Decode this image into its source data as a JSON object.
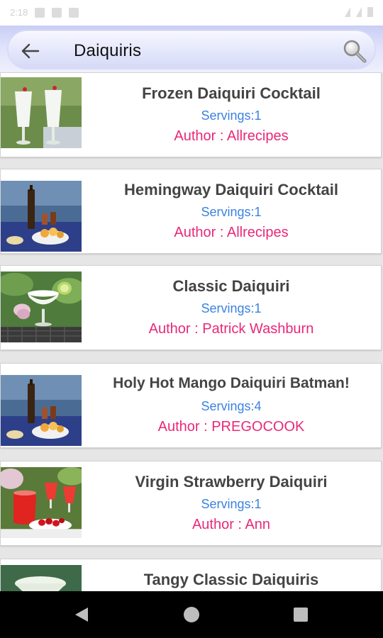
{
  "status_bar": {
    "time": "2:18"
  },
  "search": {
    "query": "Daiquiris"
  },
  "recipes": [
    {
      "title": "Frozen Daiquiri Cocktail",
      "servings": "Servings:1",
      "author": "Author : Allrecipes",
      "image": "frozen-daiquiri"
    },
    {
      "title": "Hemingway Daiquiri Cocktail",
      "servings": "Servings:1",
      "author": "Author : Allrecipes",
      "image": "wine-picnic"
    },
    {
      "title": "Classic Daiquiri",
      "servings": "Servings:1",
      "author": "Author : Patrick Washburn",
      "image": "garden-glass"
    },
    {
      "title": "Holy Hot Mango Daiquiri Batman!",
      "servings": "Servings:4",
      "author": "Author : PREGOCOOK",
      "image": "wine-picnic"
    },
    {
      "title": "Virgin Strawberry Daiquiri",
      "servings": "Servings:1",
      "author": "Author : Ann",
      "image": "strawberry-spread"
    },
    {
      "title": "Tangy Classic Daiquiris",
      "servings": "",
      "author": "",
      "image": "white-drink"
    }
  ],
  "colors": {
    "title": "#444444",
    "servings": "#3b82e0",
    "author": "#e8287a",
    "header_accent": "#c9cef4"
  },
  "icons": {
    "back": "arrow-left-icon",
    "search": "magnifier-icon",
    "nav_back": "triangle-back-icon",
    "nav_home": "circle-home-icon",
    "nav_recent": "square-recents-icon"
  }
}
